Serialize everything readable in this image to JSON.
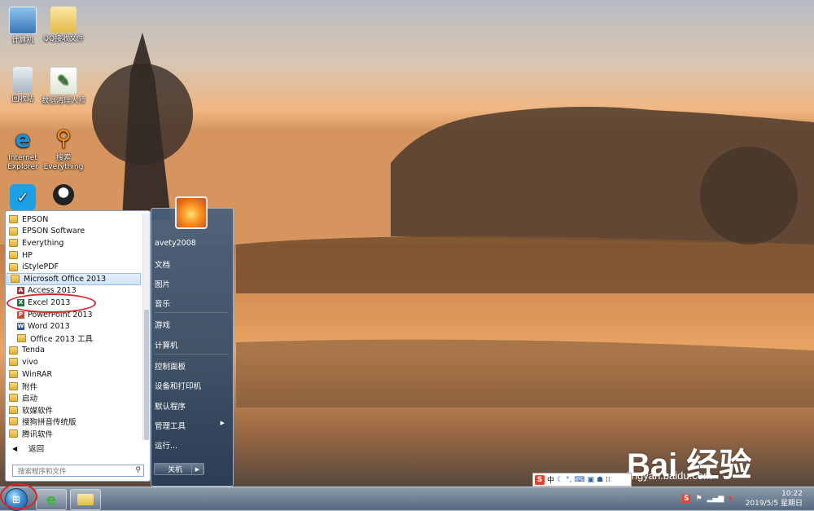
{
  "desktop": {
    "icons": [
      {
        "label": "计算机",
        "icon": "computer-icon"
      },
      {
        "label": "QQ接收文件",
        "icon": "folder-icon"
      },
      {
        "label": "回收站",
        "icon": "recycle-bin-icon"
      },
      {
        "label": "数据清理大师",
        "icon": "cleaner-icon"
      },
      {
        "label": "Internet Explorer",
        "icon": "ie-icon"
      },
      {
        "label": "搜索 Everything",
        "icon": "everything-icon"
      },
      {
        "label": "",
        "icon": "vivo-icon"
      },
      {
        "label": "",
        "icon": "qq-icon"
      }
    ]
  },
  "start_menu": {
    "programs": [
      {
        "label": "EPSON",
        "type": "folder"
      },
      {
        "label": "EPSON Software",
        "type": "folder"
      },
      {
        "label": "Everything",
        "type": "folder"
      },
      {
        "label": "HP",
        "type": "folder"
      },
      {
        "label": "iStylePDF",
        "type": "folder"
      },
      {
        "label": "Microsoft Office 2013",
        "type": "folder",
        "selected": true
      },
      {
        "label": "Access 2013",
        "type": "app",
        "icon": "access-icon",
        "color": "#a4373a",
        "letter": "A"
      },
      {
        "label": "Excel 2013",
        "type": "app",
        "icon": "excel-icon",
        "color": "#217346",
        "letter": "X"
      },
      {
        "label": "PowerPoint 2013",
        "type": "app",
        "icon": "powerpoint-icon",
        "color": "#d24726",
        "letter": "P"
      },
      {
        "label": "Word 2013",
        "type": "app",
        "icon": "word-icon",
        "color": "#2b579a",
        "letter": "W"
      },
      {
        "label": "Office 2013 工具",
        "type": "subfolder"
      },
      {
        "label": "Tenda",
        "type": "folder"
      },
      {
        "label": "vivo",
        "type": "folder"
      },
      {
        "label": "WinRAR",
        "type": "folder"
      },
      {
        "label": "附件",
        "type": "folder"
      },
      {
        "label": "启动",
        "type": "folder"
      },
      {
        "label": "软媒软件",
        "type": "folder"
      },
      {
        "label": "搜狗拼音传统版",
        "type": "folder"
      },
      {
        "label": "腾讯软件",
        "type": "folder"
      }
    ],
    "back_label": "返回",
    "search_placeholder": "搜索程序和文件",
    "right_items": [
      {
        "label": "avety2008"
      },
      {
        "label": "文档"
      },
      {
        "label": "图片"
      },
      {
        "label": "音乐"
      },
      {
        "label": "游戏"
      },
      {
        "label": "计算机"
      },
      {
        "label": "控制面板"
      },
      {
        "label": "设备和打印机"
      },
      {
        "label": "默认程序"
      },
      {
        "label": "管理工具",
        "has_submenu": true
      },
      {
        "label": "运行..."
      }
    ],
    "shutdown_label": "关机"
  },
  "ime_bar": {
    "label": "中"
  },
  "taskbar": {
    "clock_time": "10:22",
    "clock_date": "2019/5/5 星期日"
  },
  "watermark": {
    "main": "Bai  经验",
    "sub": "jingyan.baidu.com"
  },
  "colors": {
    "annotation": "#d8262c",
    "selection": "#cfe3f7"
  }
}
